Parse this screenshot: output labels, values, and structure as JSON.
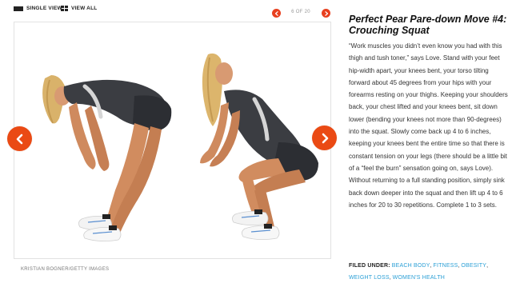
{
  "toolbar": {
    "single_view_label": "SINGLE VIEW",
    "view_all_label": "VIEW ALL"
  },
  "pager": {
    "count": "6 OF 20"
  },
  "photo": {
    "credit": "KRISTIAN BOGNER/GETTY IMAGES"
  },
  "article": {
    "title": "Perfect Pear Pare-down Move #4: Crouching Squat",
    "body": "“Work muscles you didn’t even know you had with this thigh and tush toner,” says Love. Stand with your feet hip-width apart, your knees bent, your torso tilting forward about 45 degrees from your hips with your forearms resting on your thighs. Keeping your shoulders back, your chest lifted and your knees bent, sit down lower (bending your knees not more than 90-degrees) into the squat. Slowly come back up 4 to 6 inches, keeping your knees bent the entire time so that there is constant tension on your legs (there should be a little bit of a “feel the burn” sensation going on, says Love). Without returning to a full standing position, simply sink back down deeper into the squat and then lift up 4 to 6 inches for 20 to 30 repetitions. Complete 1 to 3 sets."
  },
  "filed_under": {
    "label": "FILED UNDER:",
    "tags": [
      "BEACH BODY",
      "FITNESS",
      "OBESITY",
      "WEIGHT LOSS",
      "WOMEN'S HEALTH"
    ]
  },
  "colors": {
    "accent": "#ea4a14",
    "link": "#2a9fd6"
  },
  "icons": {
    "single_view": "single-view-icon",
    "view_all": "grid-icon",
    "prev": "chevron-left-icon",
    "next": "chevron-right-icon"
  }
}
